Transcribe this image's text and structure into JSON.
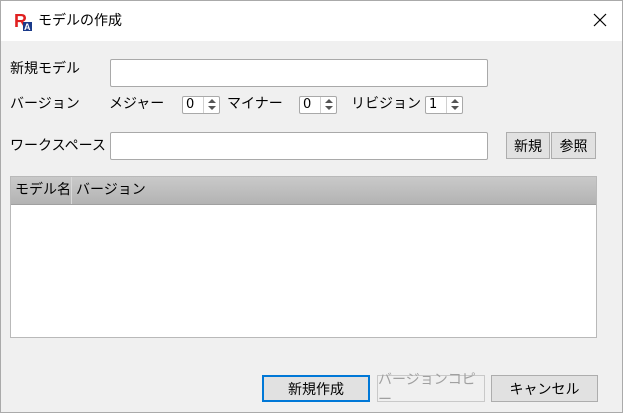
{
  "window": {
    "title": "モデルの作成"
  },
  "form": {
    "model_label": "新規モデル",
    "model_value": "",
    "version_label": "バージョン",
    "major_label": "メジャー",
    "major_value": "0",
    "minor_label": "マイナー",
    "minor_value": "0",
    "revision_label": "リビジョン",
    "revision_value": "1",
    "workspace_label": "ワークスペース",
    "workspace_value": "",
    "new_button": "新規",
    "browse_button": "参照"
  },
  "table": {
    "columns": [
      "モデル名",
      "バージョン"
    ],
    "rows": []
  },
  "footer": {
    "create_button": "新規作成",
    "copy_version_button": "バージョンコピー",
    "cancel_button": "キャンセル"
  },
  "colors": {
    "app_icon_red": "#e02020",
    "focus_border": "#0078d7"
  }
}
